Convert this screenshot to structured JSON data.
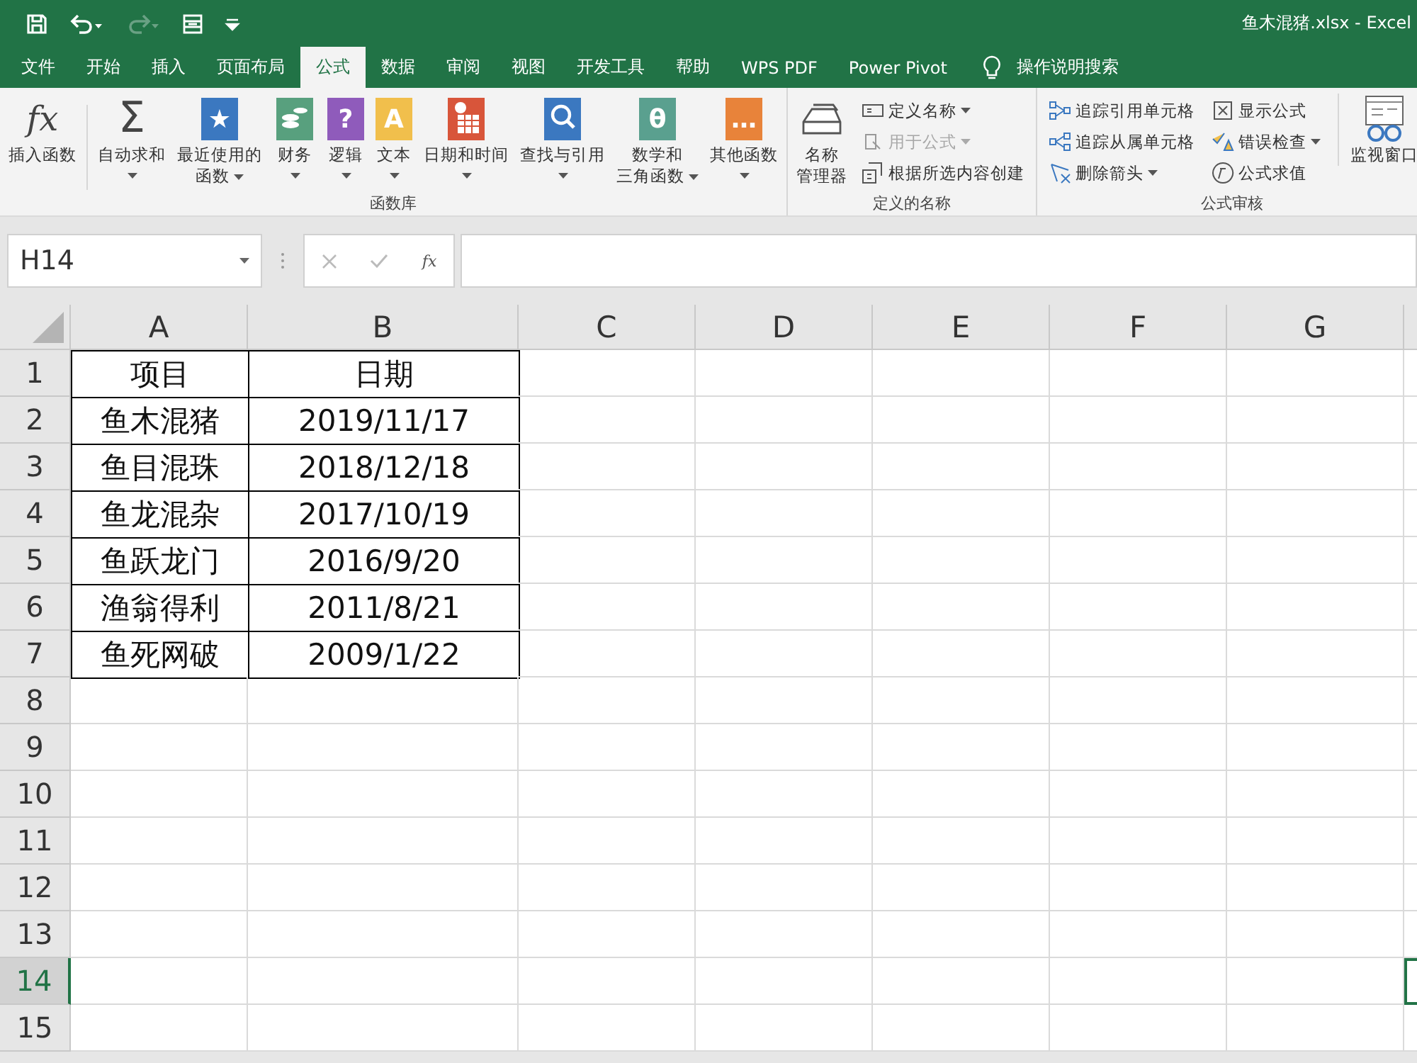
{
  "quick_access": [
    {
      "kind": "save",
      "disabled": false
    },
    {
      "kind": "undo",
      "disabled": false
    },
    {
      "kind": "redo",
      "disabled": true
    },
    {
      "kind": "form",
      "disabled": false
    },
    {
      "kind": "customize",
      "disabled": false
    }
  ],
  "window": {
    "title": "鱼木混猪.xlsx  -  Excel"
  },
  "tabs": [
    {
      "label": "文件",
      "selected": false
    },
    {
      "label": "开始",
      "selected": false
    },
    {
      "label": "插入",
      "selected": false
    },
    {
      "label": "页面布局",
      "selected": false
    },
    {
      "label": "公式",
      "selected": true
    },
    {
      "label": "数据",
      "selected": false
    },
    {
      "label": "审阅",
      "selected": false
    },
    {
      "label": "视图",
      "selected": false
    },
    {
      "label": "开发工具",
      "selected": false
    },
    {
      "label": "帮助",
      "selected": false
    },
    {
      "label": "WPS PDF",
      "selected": false
    },
    {
      "label": "Power Pivot",
      "selected": false
    }
  ],
  "tell_me": {
    "label": "操作说明搜索"
  },
  "ribbon": [
    {
      "label": "函数库",
      "buttons": [
        {
          "kind": "fx",
          "glyph": "fx",
          "lines": [
            "插入函数"
          ],
          "dropdown": false
        },
        {
          "kind": "sigma",
          "glyph": "Σ",
          "lines": [
            "自动求和"
          ],
          "dropdown": true
        },
        {
          "kind": "book",
          "glyph": "★",
          "color": "#3b78c0",
          "lines": [
            "最近使用的",
            "函数"
          ],
          "dropdown": true
        },
        {
          "kind": "finance",
          "color": "#58a07e",
          "lines": [
            "财务"
          ],
          "dropdown": true
        },
        {
          "kind": "book",
          "glyph": "?",
          "color": "#8f5bbb",
          "lines": [
            "逻辑"
          ],
          "dropdown": true
        },
        {
          "kind": "book",
          "glyph": "A",
          "color": "#f1bf4c",
          "lines": [
            "文本"
          ],
          "dropdown": true
        },
        {
          "kind": "calendar",
          "color": "#d8553a",
          "lines": [
            "日期和时间"
          ],
          "dropdown": true
        },
        {
          "kind": "lookup",
          "color": "#3b78c0",
          "lines": [
            "查找与引用"
          ],
          "dropdown": true
        },
        {
          "kind": "book",
          "glyph": "θ",
          "color": "#5aa08f",
          "lines": [
            "数学和",
            "三角函数"
          ],
          "dropdown": true
        },
        {
          "kind": "book",
          "glyph": "…",
          "color": "#e8833a",
          "lines": [
            "其他函数"
          ],
          "dropdown": true
        }
      ]
    },
    {
      "label": "定义的名称",
      "buttons": [
        {
          "kind": "names",
          "lines": [
            "名称",
            "管理器"
          ],
          "dropdown": false
        }
      ],
      "small_columns": [
        [
          {
            "kind": "define",
            "label": "定义名称",
            "dropdown": true,
            "disabled": false
          },
          {
            "kind": "use",
            "label": "用于公式",
            "dropdown": true,
            "disabled": true
          },
          {
            "kind": "create",
            "label": "根据所选内容创建",
            "dropdown": false,
            "disabled": false
          }
        ]
      ]
    },
    {
      "label": "公式审核",
      "small_columns": [
        [
          {
            "kind": "precedents",
            "label": "追踪引用单元格",
            "dropdown": false,
            "disabled": false
          },
          {
            "kind": "dependents",
            "label": "追踪从属单元格",
            "dropdown": false,
            "disabled": false
          },
          {
            "kind": "remove",
            "label": "删除箭头",
            "dropdown": true,
            "disabled": false
          }
        ],
        [
          {
            "kind": "show",
            "label": "显示公式",
            "dropdown": false,
            "disabled": false
          },
          {
            "kind": "error",
            "label": "错误检查",
            "dropdown": true,
            "disabled": false
          },
          {
            "kind": "evaluate",
            "label": "公式求值",
            "dropdown": false,
            "disabled": false
          }
        ]
      ],
      "buttons_after": [
        {
          "kind": "watch",
          "lines": [
            "监视窗口"
          ]
        }
      ]
    }
  ],
  "name_box": {
    "value": "H14"
  },
  "formula_bar": {
    "fx": "fx"
  },
  "sheet": {
    "columns": [
      {
        "label": "A"
      },
      {
        "label": "B"
      },
      {
        "label": "C"
      },
      {
        "label": "D"
      },
      {
        "label": "E"
      },
      {
        "label": "F"
      },
      {
        "label": "G"
      }
    ],
    "rows": [
      {
        "header": "1",
        "selected": false,
        "cells": [
          "项目",
          "日期"
        ]
      },
      {
        "header": "2",
        "selected": false,
        "cells": [
          "鱼木混猪",
          "2019/11/17"
        ]
      },
      {
        "header": "3",
        "selected": false,
        "cells": [
          "鱼目混珠",
          "2018/12/18"
        ]
      },
      {
        "header": "4",
        "selected": false,
        "cells": [
          "鱼龙混杂",
          "2017/10/19"
        ]
      },
      {
        "header": "5",
        "selected": false,
        "cells": [
          "鱼跃龙门",
          "2016/9/20"
        ]
      },
      {
        "header": "6",
        "selected": false,
        "cells": [
          "渔翁得利",
          "2011/8/21"
        ]
      },
      {
        "header": "7",
        "selected": false,
        "cells": [
          "鱼死网破",
          "2009/1/22"
        ]
      },
      {
        "header": "8",
        "selected": false
      },
      {
        "header": "9",
        "selected": false
      },
      {
        "header": "10",
        "selected": false
      },
      {
        "header": "11",
        "selected": false
      },
      {
        "header": "12",
        "selected": false
      },
      {
        "header": "13",
        "selected": false
      },
      {
        "header": "14",
        "selected": true
      },
      {
        "header": "15",
        "selected": false
      }
    ]
  }
}
